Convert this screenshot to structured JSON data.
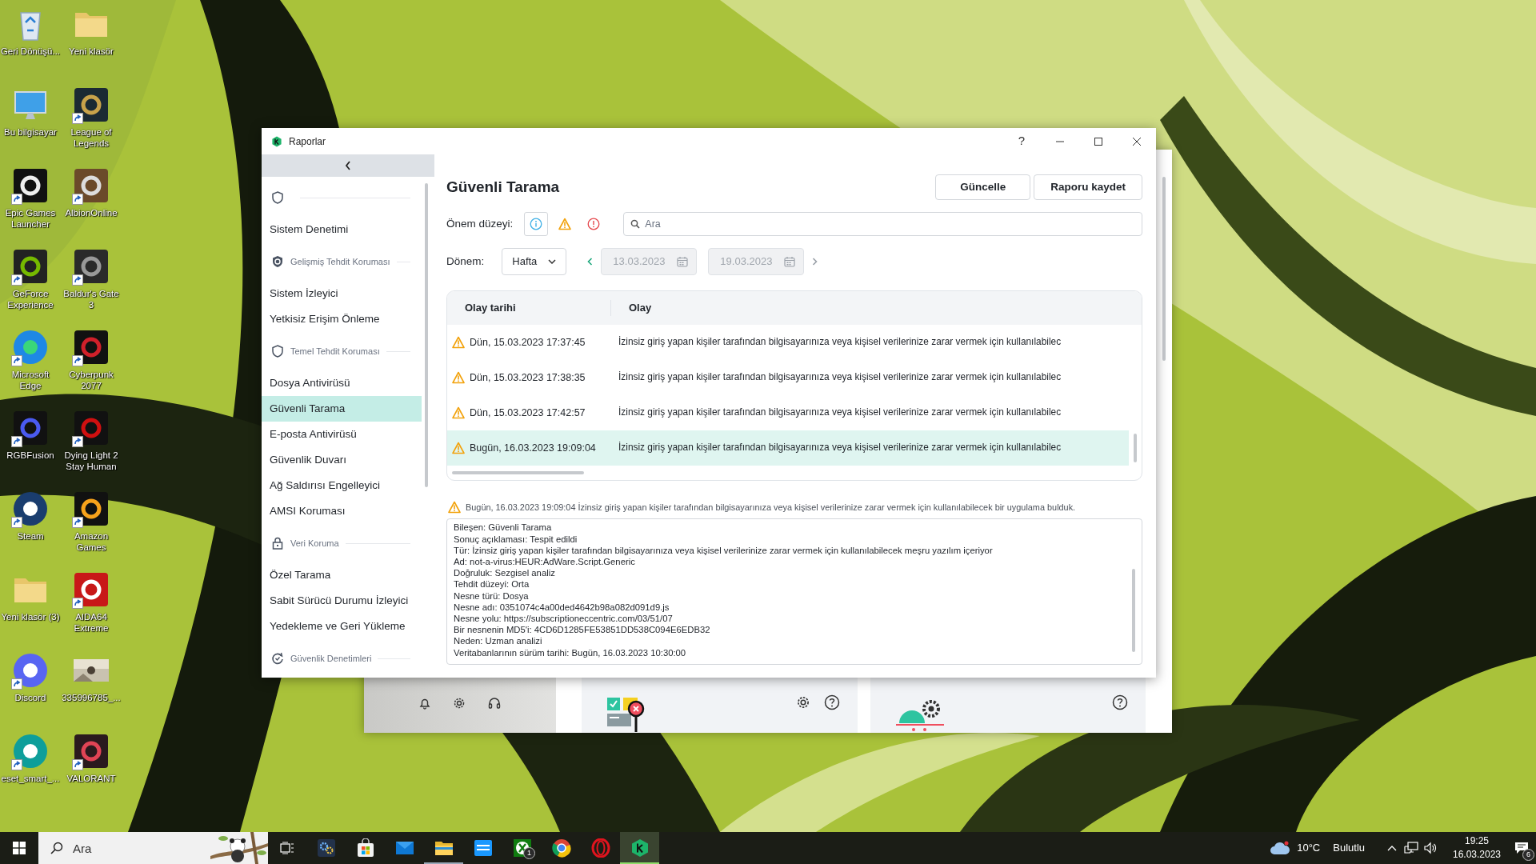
{
  "desktop_icons": [
    {
      "label": "Geri Dönüşü...",
      "shortcut": false
    },
    {
      "label": "Yeni klasör",
      "shortcut": false
    },
    {
      "label": "Bu bilgisayar",
      "shortcut": false
    },
    {
      "label": "League of Legends",
      "shortcut": true
    },
    {
      "label": "Epic Games Launcher",
      "shortcut": true
    },
    {
      "label": "AlbionOnline",
      "shortcut": true
    },
    {
      "label": "GeForce Experience",
      "shortcut": true
    },
    {
      "label": "Baldur's Gate 3",
      "shortcut": true
    },
    {
      "label": "Microsoft Edge",
      "shortcut": true
    },
    {
      "label": "Cyberpunk 2077",
      "shortcut": true
    },
    {
      "label": "RGBFusion",
      "shortcut": true
    },
    {
      "label": "Dying Light 2 Stay Human",
      "shortcut": true
    },
    {
      "label": "Steam",
      "shortcut": true
    },
    {
      "label": "Amazon Games",
      "shortcut": true
    },
    {
      "label": "Yeni klasör (3)",
      "shortcut": false
    },
    {
      "label": "AIDA64 Extreme",
      "shortcut": true
    },
    {
      "label": "Discord",
      "shortcut": true
    },
    {
      "label": "335996785_...",
      "shortcut": false
    },
    {
      "label": "eset_smart_...",
      "shortcut": true
    },
    {
      "label": "VALORANT",
      "shortcut": true
    }
  ],
  "window": {
    "title": "Raporlar",
    "help": "?"
  },
  "sidebar": {
    "groups": [
      {
        "items": [
          {
            "label": "Sistem Denetimi",
            "selected": false
          }
        ]
      },
      {
        "label": "Gelişmiş Tehdit Koruması",
        "items": [
          {
            "label": "Sistem İzleyici",
            "selected": false
          },
          {
            "label": "Yetkisiz Erişim Önleme",
            "selected": false
          }
        ]
      },
      {
        "label": "Temel Tehdit Koruması",
        "items": [
          {
            "label": "Dosya Antivirüsü",
            "selected": false
          },
          {
            "label": "Güvenli Tarama",
            "selected": true
          },
          {
            "label": "E-posta Antivirüsü",
            "selected": false
          },
          {
            "label": "Güvenlik Duvarı",
            "selected": false
          },
          {
            "label": "Ağ Saldırısı Engelleyici",
            "selected": false
          },
          {
            "label": "AMSI Koruması",
            "selected": false
          }
        ]
      },
      {
        "label": "Veri Koruma",
        "items": [
          {
            "label": "Özel Tarama",
            "selected": false
          },
          {
            "label": "Sabit Sürücü Durumu İzleyici",
            "selected": false
          },
          {
            "label": "Yedekleme ve Geri Yükleme",
            "selected": false
          }
        ]
      },
      {
        "label": "Güvenlik Denetimleri"
      }
    ]
  },
  "report": {
    "title": "Güvenli Tarama",
    "buttons": [
      "Güncelle",
      "Raporu kaydet"
    ],
    "severity": {
      "label": "Önem düzeyi:",
      "levels": [
        {
          "kind": "info",
          "selected": true
        },
        {
          "kind": "warning",
          "selected": false
        },
        {
          "kind": "error",
          "selected": false
        }
      ]
    },
    "search": {
      "placeholder": "Ara"
    },
    "period": {
      "label": "Dönem:",
      "value": "Hafta",
      "from": "13.03.2023",
      "to": "19.03.2023"
    }
  },
  "table": {
    "columns": [
      "Olay tarihi",
      "Olay"
    ],
    "rows": [
      {
        "date": "Dün, 15.03.2023 17:37:45",
        "event": "İzinsiz giriş yapan kişiler tarafından bilgisayarınıza veya kişisel verilerinize zarar vermek için kullanılabilec",
        "selected": false
      },
      {
        "date": "Dün, 15.03.2023 17:38:35",
        "event": "İzinsiz giriş yapan kişiler tarafından bilgisayarınıza veya kişisel verilerinize zarar vermek için kullanılabilec",
        "selected": false
      },
      {
        "date": "Dün, 15.03.2023 17:42:57",
        "event": "İzinsiz giriş yapan kişiler tarafından bilgisayarınıza veya kişisel verilerinize zarar vermek için kullanılabilec",
        "selected": false
      },
      {
        "date": "Bugün, 16.03.2023 19:09:04",
        "event": "İzinsiz giriş yapan kişiler tarafından bilgisayarınıza veya kişisel verilerinize zarar vermek için kullanılabilec",
        "selected": true
      }
    ]
  },
  "summary": "Bugün, 16.03.2023 19:09:04 İzinsiz giriş yapan kişiler tarafından bilgisayarınıza veya kişisel verilerinize zarar vermek için kullanılabilecek bir uygulama bulduk.",
  "details": [
    "Bileşen: Güvenli Tarama",
    "Sonuç açıklaması: Tespit edildi",
    "Tür: İzinsiz giriş yapan kişiler tarafından bilgisayarınıza veya kişisel verilerinize zarar vermek için kullanılabilecek meşru yazılım içeriyor",
    "Ad: not-a-virus:HEUR:AdWare.Script.Generic",
    "Doğruluk: Sezgisel analiz",
    "Tehdit düzeyi: Orta",
    "Nesne türü: Dosya",
    "Nesne adı: 0351074c4a00ded4642b98a082d091d9.js",
    "Nesne yolu: https://subscriptioneccentric.com/03/51/07",
    "Bir nesnenin MD5'i: 4CD6D1285FE53851DD538C094E6EDB32",
    "Neden: Uzman analizi",
    "Veritabanlarının sürüm tarihi: Bugün, 16.03.2023 10:30:00"
  ],
  "taskbar": {
    "search": {
      "placeholder": "Ara"
    },
    "apps": [
      {
        "open": false,
        "active": false
      },
      {
        "open": false,
        "active": false
      },
      {
        "open": false,
        "active": false
      },
      {
        "open": true,
        "active": false
      },
      {
        "open": false,
        "active": false
      },
      {
        "open": false,
        "active": false,
        "badge": "1"
      },
      {
        "open": false,
        "active": false
      },
      {
        "open": false,
        "active": false
      },
      {
        "open": true,
        "active": true
      }
    ],
    "weather": {
      "temperature": "10°C",
      "condition": "Bulutlu"
    },
    "clock": {
      "time": "19:25",
      "date": "16.03.2023"
    },
    "notifications": "6"
  }
}
